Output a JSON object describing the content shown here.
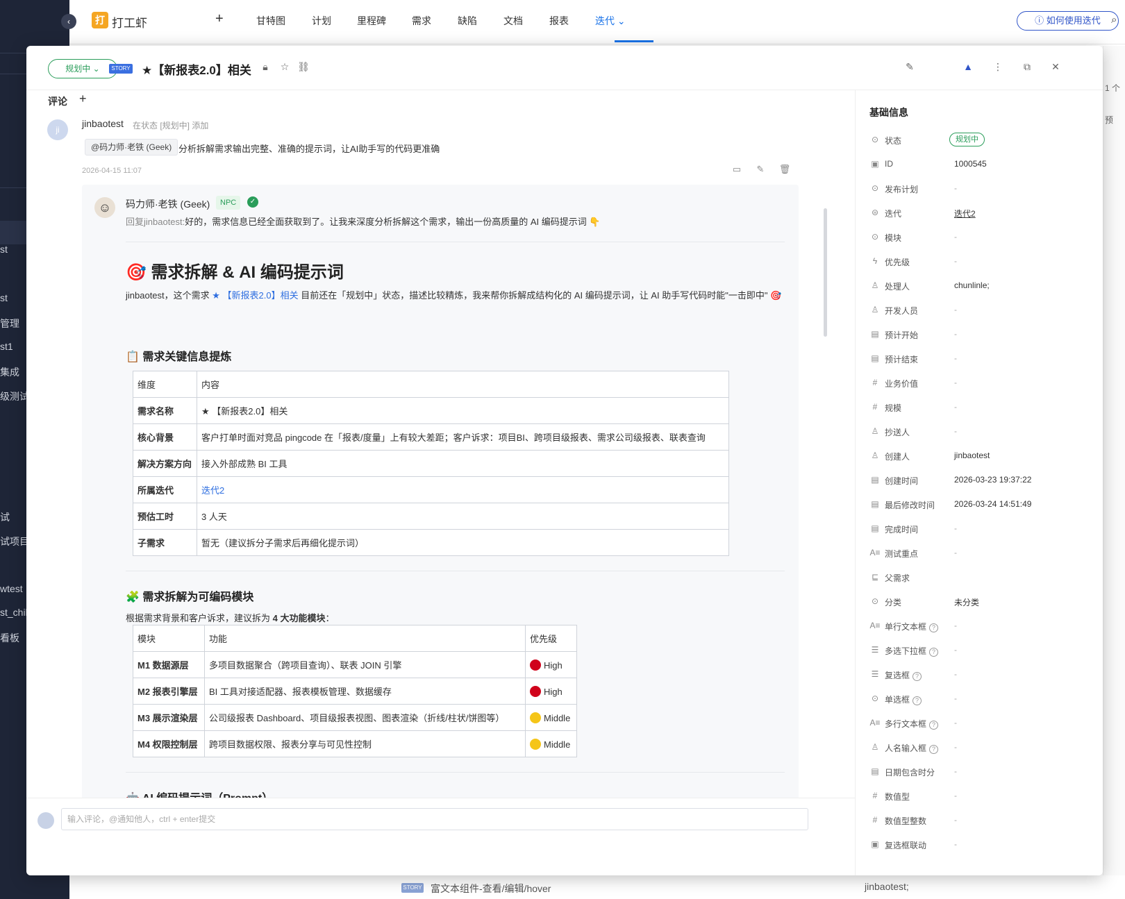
{
  "app": {
    "project_name": "打工虾",
    "logo_char": "打",
    "nav_tabs": [
      "甘特图",
      "计划",
      "里程碑",
      "需求",
      "缺陷",
      "文档",
      "报表",
      "迭代"
    ],
    "help_button": "如何使用迭代",
    "left_menu": [
      "st",
      "st",
      "管理",
      "st1",
      "集成",
      "级测试",
      "试",
      "试项目",
      "wtest",
      "st_chil",
      "看板"
    ],
    "right_peek": [
      "1 个",
      "预"
    ],
    "bottom_row": {
      "tag": "STORY",
      "title": "富文本组件-查看/编辑/hover",
      "user": "jinbaotest;"
    }
  },
  "modal": {
    "status": "规划中",
    "type_tag": "STORY",
    "title": "★【新报表2.0】相关",
    "comment_section_label": "评论",
    "comment": {
      "author": "jinbaotest",
      "avatar_initials": "ji",
      "meta": "在状态 [规划中] 添加",
      "mention": "@码力师·老铁 (Geek)",
      "text": "分析拆解需求输出完整、准确的提示词，让AI助手写的代码更准确",
      "time": "2026-04-15 11:07"
    },
    "reply": {
      "author": "码力师·老铁 (Geek)",
      "tag": "NPC",
      "reply_prefix": "回复jinbaotest:",
      "reply_text": "好的，需求信息已经全面获取到了。让我来深度分析拆解这个需求，输出一份高质量的 AI 编码提示词 👇",
      "h1": "🎯 需求拆解 & AI 编码提示词",
      "intro_pre": "jinbaotest，这个需求",
      "intro_link": "★ 【新报表2.0】相关",
      "intro_post": "目前还在「规划中」状态，描述比较精炼，我来帮你拆解成结构化的 AI 编码提示词，让 AI 助手写代码时能\"一击即中\" 🎯",
      "section1_title": "📋 需求关键信息提炼",
      "table1": {
        "headers": [
          "维度",
          "内容"
        ],
        "rows": [
          [
            "需求名称",
            "★ 【新报表2.0】相关"
          ],
          [
            "核心背景",
            "客户打单时面对竞品 pingcode 在「报表/度量」上有较大差距；客户诉求：项目BI、跨项目级报表、需求公司级报表、联表查询"
          ],
          [
            "解决方案方向",
            "接入外部成熟 BI 工具"
          ],
          [
            "所属迭代",
            "迭代2"
          ],
          [
            "预估工时",
            "3 人天"
          ],
          [
            "子需求",
            "暂无（建议拆分子需求后再细化提示词）"
          ]
        ]
      },
      "section2_title": "🧩 需求拆解为可编码模块",
      "section2_intro_pre": "根据需求背景和客户诉求，建议拆为",
      "section2_intro_bold": "4 大功能模块",
      "section2_intro_post": "：",
      "table2": {
        "headers": [
          "模块",
          "功能",
          "优先级"
        ],
        "rows": [
          [
            "M1 数据源层",
            "多项目数据聚合（跨项目查询）、联表 JOIN 引擎",
            "High",
            "#d0021b"
          ],
          [
            "M2 报表引擎层",
            "BI 工具对接适配器、报表模板管理、数据缓存",
            "High",
            "#d0021b"
          ],
          [
            "M3 展示渲染层",
            "公司级报表 Dashboard、项目级报表视图、图表渲染（折线/柱状/饼图等）",
            "Middle",
            "#f5c518"
          ],
          [
            "M4 权限控制层",
            "跨项目数据权限、报表分享与可见性控制",
            "Middle",
            "#f5c518"
          ]
        ]
      },
      "section3_title": "🤖 AI 编码提示词（Prompt）"
    },
    "comment_input_placeholder": "输入评论，@通知他人，ctrl + enter提交"
  },
  "sidebar": {
    "title": "基础信息",
    "fields": [
      {
        "icon": "⊙",
        "label": "状态",
        "value": "规划中",
        "kind": "pill"
      },
      {
        "icon": "▣",
        "label": "ID",
        "value": "1000545"
      },
      {
        "icon": "⊙",
        "label": "发布计划",
        "value": "-"
      },
      {
        "icon": "⊜",
        "label": "迭代",
        "value": "迭代2",
        "kind": "link"
      },
      {
        "icon": "⊙",
        "label": "模块",
        "value": "-"
      },
      {
        "icon": "ϟ",
        "label": "优先级",
        "value": "-"
      },
      {
        "icon": "♙",
        "label": "处理人",
        "value": "chunlinle;"
      },
      {
        "icon": "♙",
        "label": "开发人员",
        "value": "-"
      },
      {
        "icon": "▤",
        "label": "预计开始",
        "value": "-"
      },
      {
        "icon": "▤",
        "label": "预计结束",
        "value": "-"
      },
      {
        "icon": "#",
        "label": "业务价值",
        "value": "-"
      },
      {
        "icon": "#",
        "label": "规模",
        "value": "-"
      },
      {
        "icon": "♙",
        "label": "抄送人",
        "value": "-"
      },
      {
        "icon": "♙",
        "label": "创建人",
        "value": "jinbaotest"
      },
      {
        "icon": "▤",
        "label": "创建时间",
        "value": "2026-03-23 19:37:22"
      },
      {
        "icon": "▤",
        "label": "最后修改时间",
        "value": "2026-03-24 14:51:49"
      },
      {
        "icon": "▤",
        "label": "完成时间",
        "value": "-"
      },
      {
        "icon": "A≡",
        "label": "测试重点",
        "value": "-"
      },
      {
        "icon": "⊑",
        "label": "父需求",
        "value": ""
      },
      {
        "icon": "⊙",
        "label": "分类",
        "value": "未分类"
      },
      {
        "icon": "A≡",
        "label": "单行文本框",
        "value": "-",
        "help": true
      },
      {
        "icon": "☰",
        "label": "多选下拉框",
        "value": "-",
        "help": true
      },
      {
        "icon": "☰",
        "label": "复选框",
        "value": "-",
        "help": true
      },
      {
        "icon": "⊙",
        "label": "单选框",
        "value": "-",
        "help": true
      },
      {
        "icon": "A≡",
        "label": "多行文本框",
        "value": "-",
        "help": true
      },
      {
        "icon": "♙",
        "label": "人名输入框",
        "value": "-",
        "help": true
      },
      {
        "icon": "▤",
        "label": "日期包含时分",
        "value": "-"
      },
      {
        "icon": "#",
        "label": "数值型",
        "value": "-"
      },
      {
        "icon": "#",
        "label": "数值型整数",
        "value": "-"
      },
      {
        "icon": "▣",
        "label": "复选框联动",
        "value": "-"
      }
    ]
  }
}
